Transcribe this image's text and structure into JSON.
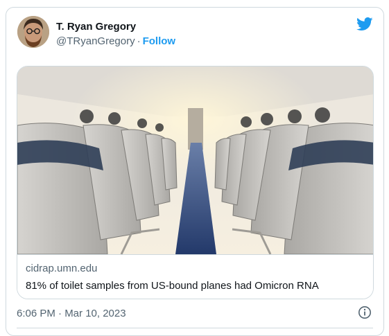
{
  "tweet": {
    "author_name": "T. Ryan Gregory",
    "handle": "@TRyanGregory",
    "separator": "·",
    "follow_label": "Follow",
    "timestamp": "6:06 PM · Mar 10, 2023"
  },
  "link_card": {
    "domain": "cidrap.umn.edu",
    "title": "81% of toilet samples from US-bound planes had Omicron RNA"
  },
  "icons": {
    "brand": "twitter-bird-icon",
    "info": "info-icon"
  },
  "colors": {
    "accent": "#1d9bf0",
    "text_primary": "#0f1419",
    "text_secondary": "#536471",
    "border": "#cfd9de"
  }
}
